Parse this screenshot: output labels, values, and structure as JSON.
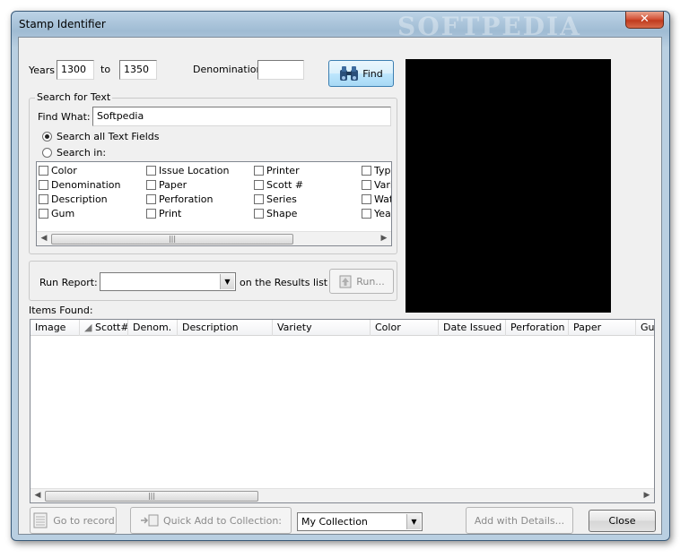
{
  "window": {
    "title": "Stamp Identifier",
    "watermark": "SOFTPEDIA",
    "close_glyph": "✕"
  },
  "years": {
    "label": "Years",
    "from": "1300",
    "to_label": "to",
    "to": "1350"
  },
  "denomination": {
    "label": "Denomination",
    "value": ""
  },
  "find_button": {
    "label": "Find",
    "icon": "binoculars-icon"
  },
  "search": {
    "group_title": "Search for Text",
    "find_what_label": "Find What:",
    "find_what_value": "Softpedia",
    "radio_all": "Search all Text Fields",
    "radio_in": "Search in:",
    "selected": "all",
    "fields": [
      [
        "Color",
        "Issue Location",
        "Printer",
        "Type"
      ],
      [
        "Denomination",
        "Paper",
        "Scott #",
        "Variety"
      ],
      [
        "Description",
        "Perforation",
        "Series",
        "Watermark"
      ],
      [
        "Gum",
        "Print",
        "Shape",
        "Year"
      ]
    ]
  },
  "report": {
    "label": "Run Report:",
    "value": "",
    "suffix": "on the Results list",
    "run_button": "Run..."
  },
  "items": {
    "label": "Items Found:",
    "columns": [
      "Image",
      "Scott#",
      "Denom.",
      "Description",
      "Variety",
      "Color",
      "Date Issued",
      "Perforation",
      "Paper",
      "Gum"
    ],
    "rows": []
  },
  "bottom": {
    "goto_label": "Go to record",
    "quick_add_label": "Quick Add to Collection:",
    "collection_value": "My Collection",
    "add_details_label": "Add with Details...",
    "close_label": "Close"
  },
  "scroll_thumb": "|||"
}
